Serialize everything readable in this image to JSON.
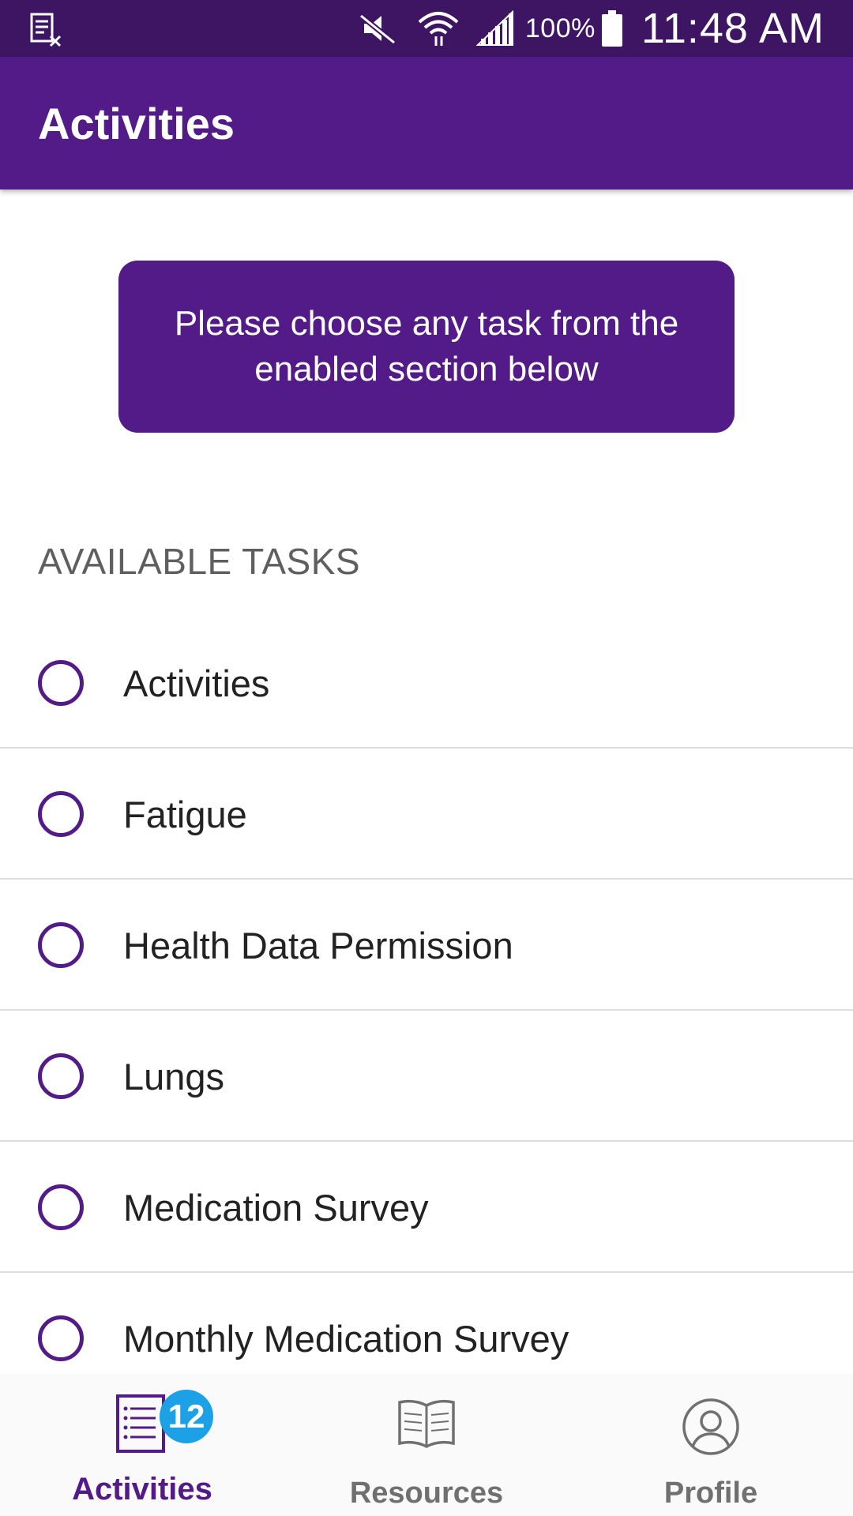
{
  "status_bar": {
    "icons": [
      "notification-icon",
      "mute-icon",
      "wifi-icon",
      "signal-icon",
      "battery-icon"
    ],
    "battery_percent": "100%",
    "time": "11:48 AM"
  },
  "app_bar": {
    "title": "Activities"
  },
  "banner": {
    "text": "Please choose any task from the enabled section below"
  },
  "tasks": {
    "section_title": "AVAILABLE TASKS",
    "items": [
      {
        "label": "Activities"
      },
      {
        "label": "Fatigue"
      },
      {
        "label": "Health Data Permission"
      },
      {
        "label": "Lungs"
      },
      {
        "label": "Medication Survey"
      },
      {
        "label": "Monthly Medication Survey"
      }
    ]
  },
  "bottom_nav": {
    "items": [
      {
        "label": "Activities",
        "icon": "list-icon",
        "badge": "12",
        "active": true
      },
      {
        "label": "Resources",
        "icon": "book-icon",
        "active": false
      },
      {
        "label": "Profile",
        "icon": "person-icon",
        "active": false
      }
    ]
  },
  "colors": {
    "primary": "#521b87",
    "status_bar": "#3d1563",
    "badge": "#1da1e6",
    "inactive_nav": "#707070"
  }
}
